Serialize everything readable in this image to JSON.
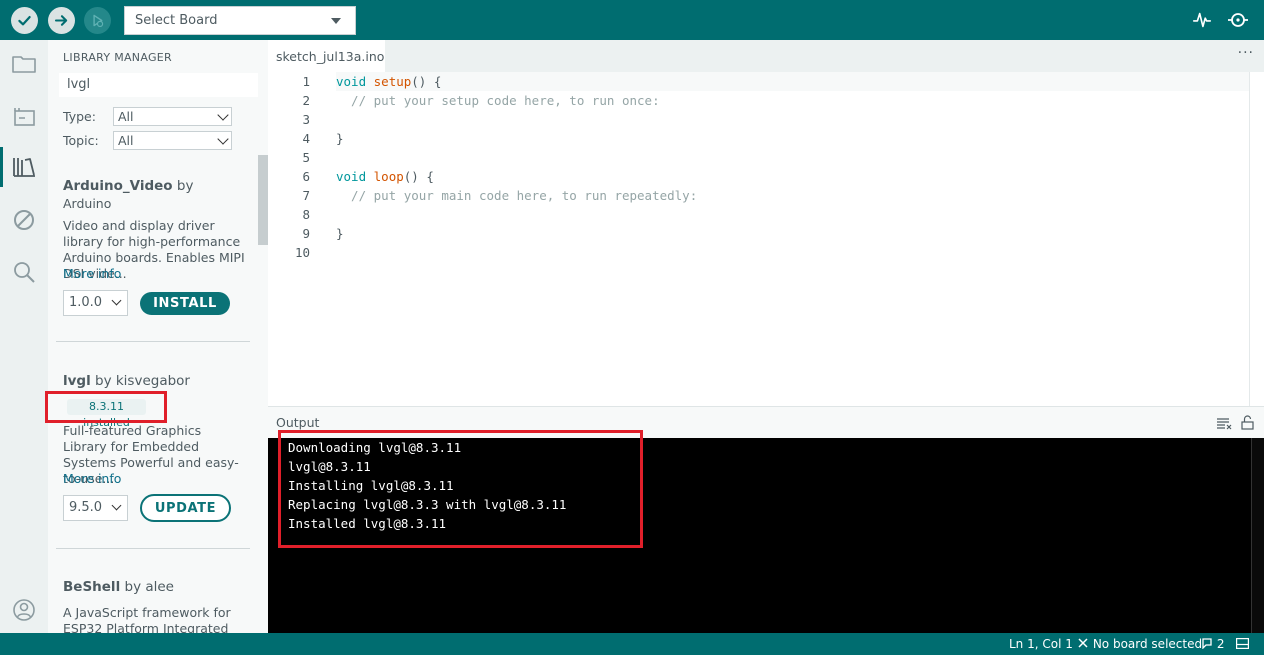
{
  "toolbar": {
    "verify_icon": "check-icon",
    "upload_icon": "arrow-right-icon",
    "debug_icon": "debug-icon",
    "board_select": "Select Board",
    "serial_plotter_icon": "pulse-icon",
    "serial_monitor_icon": "magnifier-icon"
  },
  "activity_bar": [
    "folder-icon",
    "board-icon",
    "library-icon",
    "debug-ban-icon",
    "search-icon",
    "account-icon"
  ],
  "library_manager": {
    "title": "LIBRARY MANAGER",
    "search_value": "lvgl",
    "type_label": "Type:",
    "type_value": "All",
    "topic_label": "Topic:",
    "topic_value": "All",
    "libraries": [
      {
        "name": "Arduino_Video",
        "by": "by",
        "author": "Arduino",
        "description": "Video and display driver library for high-performance Arduino boards. Enables MIPI DSI vide...",
        "more_info": "More info",
        "version": "1.0.0",
        "action": "INSTALL"
      },
      {
        "name": "lvgl",
        "by": "by kisvegabor",
        "installed": "8.3.11 installed",
        "description": "Full-featured Graphics Library for Embedded Systems Powerful and easy-to-use...",
        "more_info": "More info",
        "version": "9.5.0",
        "action": "UPDATE"
      },
      {
        "name": "BeShell",
        "by": "by alee",
        "description": "A JavaScript framework for ESP32 Platform Integrated"
      }
    ]
  },
  "editor": {
    "tab_name": "sketch_jul13a.ino",
    "more_icon": "ellipsis-icon",
    "line_numbers": [
      "1",
      "2",
      "3",
      "4",
      "5",
      "6",
      "7",
      "8",
      "9",
      "10"
    ],
    "lines": [
      {
        "kw": "void ",
        "fn": "setup",
        "rest": "() {"
      },
      {
        "cm": "  // put your setup code here, to run once:"
      },
      {
        "rest": ""
      },
      {
        "rest": "}"
      },
      {
        "rest": ""
      },
      {
        "kw": "void ",
        "fn": "loop",
        "rest": "() {"
      },
      {
        "cm": "  // put your main code here, to run repeatedly:"
      },
      {
        "rest": ""
      },
      {
        "rest": "}"
      },
      {
        "rest": ""
      }
    ]
  },
  "output": {
    "title": "Output",
    "clear_icon": "clear-lines-icon",
    "lock_icon": "unlock-icon",
    "lines": [
      "Downloading lvgl@8.3.11",
      "lvgl@8.3.11",
      "Installing lvgl@8.3.11",
      "Replacing lvgl@8.3.3 with lvgl@8.3.11",
      "Installed lvgl@8.3.11"
    ]
  },
  "status_bar": {
    "position": "Ln 1, Col 1",
    "board": "No board selected",
    "notifications": "2"
  }
}
